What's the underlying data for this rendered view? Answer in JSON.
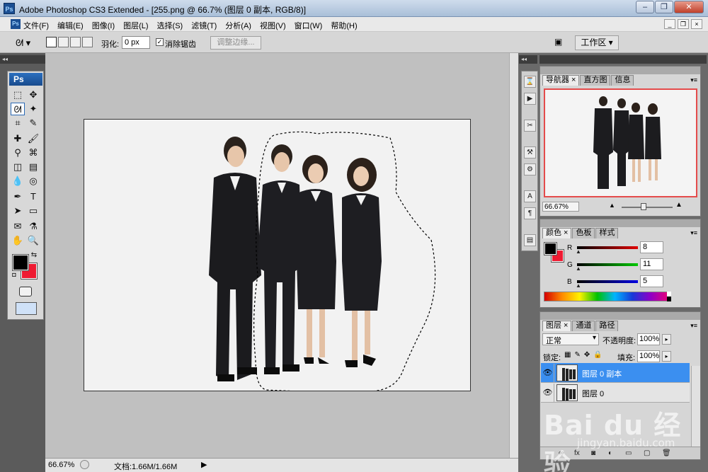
{
  "window": {
    "title": "Adobe Photoshop CS3 Extended - [255.png @ 66.7% (图层 0 副本, RGB/8)]",
    "app_icon": "Ps",
    "buttons": [
      "–",
      "❐",
      "✕"
    ]
  },
  "menubar": {
    "items": [
      "文件(F)",
      "编辑(E)",
      "图像(I)",
      "图层(L)",
      "选择(S)",
      "滤镜(T)",
      "分析(A)",
      "视图(V)",
      "窗口(W)",
      "帮助(H)"
    ],
    "mdi_buttons": [
      "_",
      "❐",
      "×"
    ]
  },
  "options": {
    "tool_icon": "lasso-icon",
    "feather_label": "羽化:",
    "feather_value": "0 px",
    "antialias_checked": "✓",
    "antialias_label": "消除锯齿",
    "refine_edge": "调整边缘...",
    "workspace_label": "工作区 ▾"
  },
  "toolbox": {
    "logo": "Ps",
    "fg_color": "#000000",
    "bg_color": "#ee1b32"
  },
  "canvas": {
    "people": 4,
    "selection": "marching-ants around three people"
  },
  "statusbar": {
    "zoom": "66.67%",
    "doc": "文档:1.66M/1.66M",
    "arrow": "▶"
  },
  "navigator": {
    "tabs": [
      "导航器",
      "直方图",
      "信息"
    ],
    "zoom": "66.67%"
  },
  "color_panel": {
    "tabs": [
      "颜色",
      "色板",
      "样式"
    ],
    "channels": [
      {
        "label": "R",
        "value": "8",
        "gradient": "linear-gradient(to right,#000,#e00000)"
      },
      {
        "label": "G",
        "value": "11",
        "gradient": "linear-gradient(to right,#000,#00c800)"
      },
      {
        "label": "B",
        "value": "5",
        "gradient": "linear-gradient(to right,#000,#0000e0)"
      }
    ]
  },
  "layers_panel": {
    "tabs": [
      "图层",
      "通道",
      "路径"
    ],
    "blend_mode": "正常",
    "opacity_label": "不透明度:",
    "opacity": "100%",
    "lock_label": "锁定:",
    "fill_label": "填充:",
    "fill": "100%",
    "layers": [
      {
        "name": "图层 0 副本",
        "selected": true
      },
      {
        "name": "图层 0",
        "selected": false
      }
    ]
  },
  "watermark": {
    "main": "Bai du 经验",
    "sub": "jingyan.baidu.com"
  }
}
